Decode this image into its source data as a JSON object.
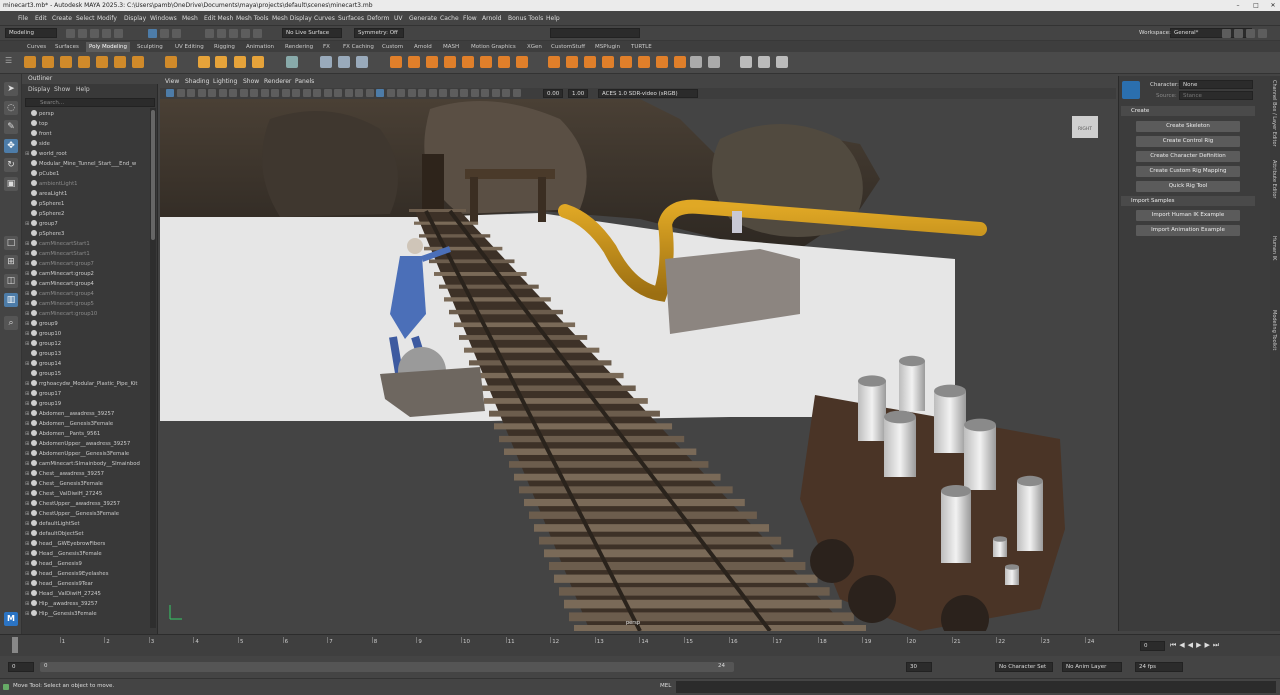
{
  "window": {
    "title": "minecart3.mb* - Autodesk MAYA 2025.3: C:\\Users\\pamb\\OneDrive\\Documents\\maya\\projects\\default\\scenes\\minecart3.mb"
  },
  "menu": {
    "items": [
      "File",
      "Edit",
      "Create",
      "Select",
      "Modify",
      "Display",
      "Windows",
      "Mesh",
      "Edit Mesh",
      "Mesh Tools",
      "Mesh Display",
      "Curves",
      "Surfaces",
      "Deform",
      "UV",
      "Generate",
      "Cache",
      "Flow",
      "Arnold",
      "Bonus Tools",
      "Help"
    ],
    "workspace_label": "Workspace:",
    "workspace_value": "General*"
  },
  "statusline": {
    "mode": "Modeling",
    "live_surface": "No Live Surface",
    "symmetry": "Symmetry: Off"
  },
  "shelf": {
    "tabs": [
      "Curves",
      "Surfaces",
      "Poly Modeling",
      "Sculpting",
      "UV Editing",
      "Rigging",
      "Animation",
      "Rendering",
      "FX",
      "FX Caching",
      "Custom",
      "Arnold",
      "MASH",
      "Motion Graphics",
      "XGen",
      "CustomStuff",
      "MSPlugin",
      "TURTLE"
    ],
    "active_tab": "Poly Modeling"
  },
  "outliner": {
    "title": "Outliner",
    "menu": [
      "Display",
      "Show",
      "Help"
    ],
    "search_placeholder": "Search...",
    "rows": [
      {
        "label": "persp",
        "grey": false,
        "expand": false
      },
      {
        "label": "top",
        "grey": false,
        "expand": false
      },
      {
        "label": "front",
        "grey": false,
        "expand": false
      },
      {
        "label": "side",
        "grey": false,
        "expand": false
      },
      {
        "label": "world_root",
        "grey": false,
        "expand": true
      },
      {
        "label": "Modular_Mine_Tunnel_Start___End_w",
        "grey": false,
        "expand": false
      },
      {
        "label": "pCube1",
        "grey": false,
        "expand": false
      },
      {
        "label": "ambientLight1",
        "grey": true,
        "expand": false
      },
      {
        "label": "areaLight1",
        "grey": false,
        "expand": false
      },
      {
        "label": "pSphere1",
        "grey": false,
        "expand": false
      },
      {
        "label": "pSphere2",
        "grey": false,
        "expand": false
      },
      {
        "label": "group7",
        "grey": false,
        "expand": true
      },
      {
        "label": "pSphere3",
        "grey": false,
        "expand": false
      },
      {
        "label": "camMinecartStart1",
        "grey": true,
        "expand": true
      },
      {
        "label": "camMinecartStart1",
        "grey": true,
        "expand": true
      },
      {
        "label": "camMinecart:group7",
        "grey": true,
        "expand": true
      },
      {
        "label": "camMinecart:group2",
        "grey": false,
        "expand": true
      },
      {
        "label": "camMinecart:group4",
        "grey": false,
        "expand": true
      },
      {
        "label": "camMinecart:group4",
        "grey": true,
        "expand": true
      },
      {
        "label": "camMinecart:group5",
        "grey": true,
        "expand": true
      },
      {
        "label": "camMinecart:group10",
        "grey": true,
        "expand": true
      },
      {
        "label": "group9",
        "grey": false,
        "expand": true
      },
      {
        "label": "group10",
        "grey": false,
        "expand": true
      },
      {
        "label": "group12",
        "grey": false,
        "expand": true
      },
      {
        "label": "group13",
        "grey": false,
        "expand": false
      },
      {
        "label": "group14",
        "grey": false,
        "expand": true
      },
      {
        "label": "group15",
        "grey": false,
        "expand": false
      },
      {
        "label": "rrghoacydw_Modular_Plastic_Pipe_Kit",
        "grey": false,
        "expand": true
      },
      {
        "label": "group17",
        "grey": false,
        "expand": true
      },
      {
        "label": "group19",
        "grey": false,
        "expand": true
      },
      {
        "label": "Abdomen__awadress_39257",
        "grey": false,
        "expand": true
      },
      {
        "label": "Abdomen__Genesis3Female",
        "grey": false,
        "expand": true
      },
      {
        "label": "Abdomen__Pants_9561",
        "grey": false,
        "expand": true
      },
      {
        "label": "AbdomenUpper__awadress_39257",
        "grey": false,
        "expand": true
      },
      {
        "label": "AbdomenUpper__Genesis3Female",
        "grey": false,
        "expand": true
      },
      {
        "label": "camMinecart:SImainbody__SImainbod",
        "grey": false,
        "expand": true
      },
      {
        "label": "Chest__awadress_39257",
        "grey": false,
        "expand": true
      },
      {
        "label": "Chest__Genesis3Female",
        "grey": false,
        "expand": true
      },
      {
        "label": "Chest__ValDiwiH_27245",
        "grey": false,
        "expand": true
      },
      {
        "label": "ChestUpper__awadress_39257",
        "grey": false,
        "expand": true
      },
      {
        "label": "ChestUpper__Genesis3Female",
        "grey": false,
        "expand": true
      },
      {
        "label": "defaultLightSet",
        "grey": false,
        "expand": true
      },
      {
        "label": "defaultObjectSet",
        "grey": false,
        "expand": true
      },
      {
        "label": "head__GWEyebrowFibers",
        "grey": false,
        "expand": true
      },
      {
        "label": "Head__Genesis3Female",
        "grey": false,
        "expand": true
      },
      {
        "label": "head__Genesis9",
        "grey": false,
        "expand": true
      },
      {
        "label": "head__Genesis9Eyelashes",
        "grey": false,
        "expand": true
      },
      {
        "label": "head__Genesis9Tear",
        "grey": false,
        "expand": true
      },
      {
        "label": "Head__ValDiwiH_27245",
        "grey": false,
        "expand": true
      },
      {
        "label": "Hip__awadress_39257",
        "grey": false,
        "expand": true
      },
      {
        "label": "Hip__Genesis3Female",
        "grey": false,
        "expand": true
      }
    ]
  },
  "viewport": {
    "menu": [
      "View",
      "Shading",
      "Lighting",
      "Show",
      "Renderer",
      "Panels"
    ],
    "exposure": "0.00",
    "gamma": "1.00",
    "colorspace": "ACES 1.0 SDR-video (sRGB)",
    "camera": "persp",
    "viewcube": "RIGHT"
  },
  "right_panel": {
    "character_label": "Character:",
    "character_value": "None",
    "source_label": "Source:",
    "source_value": "Stance",
    "create_section": "Create",
    "create_buttons": [
      "Create Skeleton",
      "Create Control Rig",
      "Create Character Definition",
      "Create Custom Rig Mapping",
      "Quick Rig Tool"
    ],
    "import_section": "Import Samples",
    "import_buttons": [
      "Import Human IK Example",
      "Import Animation Example"
    ]
  },
  "side_tabs": [
    "Channel Box / Layer Editor",
    "Attribute Editor",
    "Human IK",
    "Modeling Toolkit"
  ],
  "timeline": {
    "ticks": [
      "1",
      "2",
      "3",
      "4",
      "5",
      "6",
      "7",
      "8",
      "9",
      "10",
      "11",
      "12",
      "13",
      "14",
      "15",
      "16",
      "17",
      "18",
      "19",
      "20",
      "21",
      "22",
      "23",
      "24"
    ],
    "current_frame": "0",
    "range_start": "0",
    "range_inner_start": "0",
    "range_inner_end": "24",
    "range_end": "30",
    "character_set": "No Character Set",
    "anim_layer": "No Anim Layer",
    "fps": "24 fps"
  },
  "command_line": {
    "help_text": "Move Tool: Select an object to move.",
    "lang": "MEL"
  },
  "colors": {
    "accent": "#4d7ca8",
    "viewport_bg": "#444444",
    "ui_bg": "#444444"
  }
}
